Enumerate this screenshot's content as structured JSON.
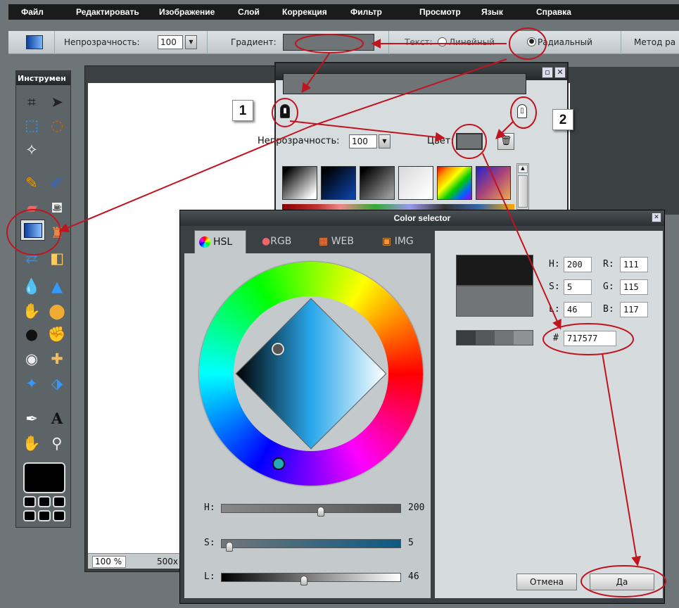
{
  "menu": {
    "items": [
      "Файл",
      "Редактировать",
      "Изображение",
      "Слой",
      "Коррекция",
      "Фильтр",
      "Просмотр",
      "Язык",
      "Справка"
    ]
  },
  "options": {
    "opacity_label": "Непрозрачность:",
    "opacity_value": "100",
    "gradient_label": "Градиент:",
    "text_label": "Текст:",
    "linear_label": "Линейный",
    "radial_label": "Радиальный",
    "method_label": "Метод ра"
  },
  "toolbox": {
    "title": "Инструмен"
  },
  "canvas": {
    "zoom": "100 %",
    "size": "500x"
  },
  "gradient_panel": {
    "opacity_label": "Непрозрачность:",
    "opacity_value": "100",
    "color_label": "Цвет:",
    "current_color": "#717577"
  },
  "annotations": {
    "num1": "1",
    "num2": "2"
  },
  "color_selector": {
    "title": "Color selector",
    "tabs": [
      "HSL",
      "RGB",
      "WEB",
      "IMG"
    ],
    "h_label": "H:",
    "s_label": "S:",
    "l_label": "L:",
    "h_value": "200",
    "s_value": "5",
    "l_value": "46",
    "r_label": "R:",
    "g_label": "G:",
    "b_label": "B:",
    "r_value": "111",
    "g_value": "115",
    "b_value": "117",
    "hash_label": "#",
    "hex_value": "717577",
    "h_slider_value": "200",
    "s_slider_value": "5",
    "l_slider_value": "46",
    "h_fraction": 0.556,
    "s_fraction": 0.05,
    "l_fraction": 0.46,
    "new_color": "#1a1a1a",
    "old_color": "#717577",
    "cancel_label": "Отмена",
    "ok_label": "Да"
  },
  "colors": {
    "accent_red": "#c0141e",
    "panel_dark": "#2c3134"
  }
}
